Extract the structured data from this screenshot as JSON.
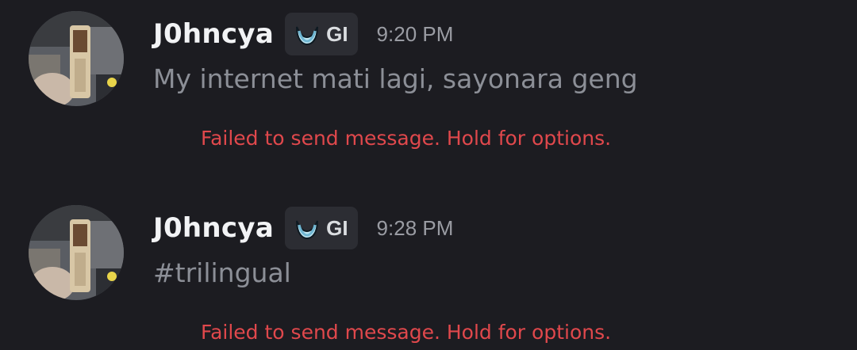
{
  "colors": {
    "background": "#1c1c21",
    "username": "#f2f3f5",
    "message_text": "#8c8f97",
    "timestamp": "#9a9ca3",
    "error": "#e0484c",
    "badge_background": "#2c2d33"
  },
  "messages": [
    {
      "avatar_icon": "user-avatar-photo",
      "username": "J0hncya",
      "badge": {
        "icon": "guild-tag-moon-icon",
        "tag": "GI"
      },
      "timestamp": "9:20 PM",
      "content": "My internet mati lagi, sayonara geng",
      "error": "Failed to send message. Hold for options."
    },
    {
      "avatar_icon": "user-avatar-photo",
      "username": "J0hncya",
      "badge": {
        "icon": "guild-tag-moon-icon",
        "tag": "GI"
      },
      "timestamp": "9:28 PM",
      "content": "#trilingual",
      "error": "Failed to send message. Hold for options."
    }
  ]
}
